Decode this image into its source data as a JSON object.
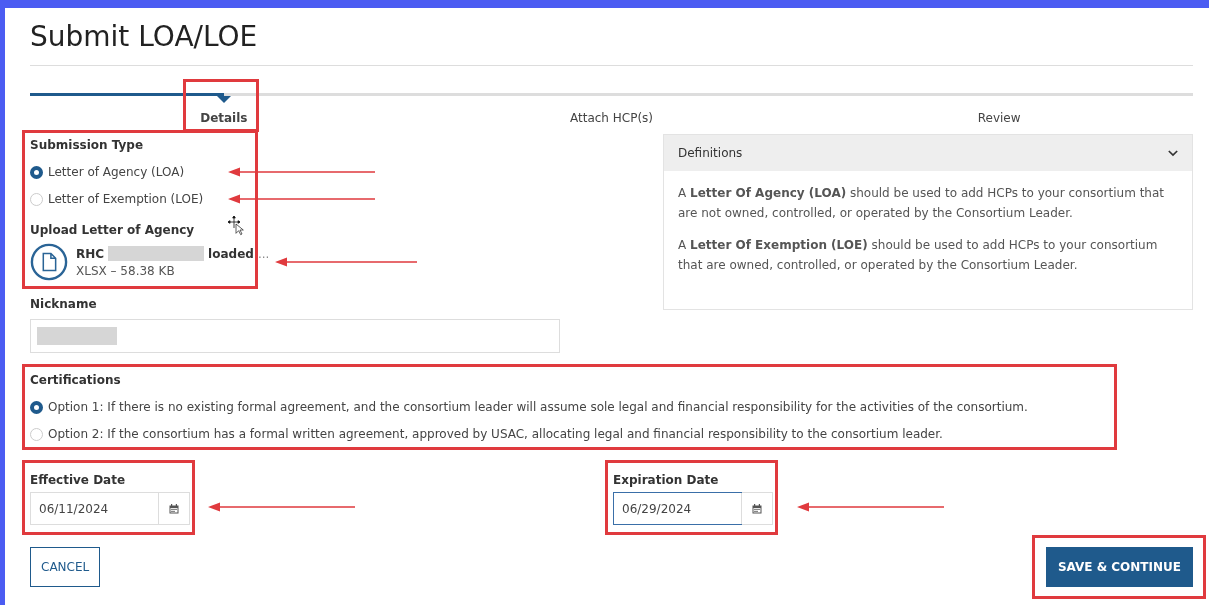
{
  "title": "Submit LOA/LOE",
  "steps": [
    {
      "label": "Details",
      "selected": true
    },
    {
      "label": "Attach HCP(s)",
      "selected": false
    },
    {
      "label": "Review",
      "selected": false
    }
  ],
  "step_progress": {
    "level": 0.167
  },
  "submission_type": {
    "label": "Submission Type",
    "options": [
      {
        "label": "Letter of Agency (LOA)",
        "selected": true
      },
      {
        "label": "Letter of Exemption (LOE)",
        "selected": false
      }
    ]
  },
  "upload": {
    "label": "Upload Letter of Agency",
    "file": {
      "name_start": "RHC",
      "name_end": "loaded",
      "ellipsis": "...",
      "details": "XLSX – 58.38 KB"
    }
  },
  "nickname": {
    "label": "Nickname"
  },
  "definitions": {
    "title": "Definitions",
    "expanded": true,
    "paragraphs": [
      "A **Letter Of Agency (LOA)** should be used to add HCPs to your consortium that are not owned, controlled, or operated by the Consortium Leader.",
      "A **Letter Of Exemption (LOE)** should be used to add HCPs to your consortium that are owned, controlled, or operated by the Consortium Leader."
    ]
  },
  "certifications": {
    "label": "Certifications",
    "options": [
      {
        "label": "Option 1: If there is no existing formal agreement, and the consortium leader will assume sole legal and financial responsibility for the activities of the consortium.",
        "selected": true
      },
      {
        "label": "Option 2: If the consortium has a formal written agreement, approved by USAC, allocating legal and financial responsibility to the consortium leader.",
        "selected": false
      }
    ]
  },
  "effective_date": {
    "label": "Effective Date",
    "value": "06/11/2024",
    "focused": false
  },
  "expiration_date": {
    "label": "Expiration Date",
    "value": "06/29/2024",
    "focused": true
  },
  "buttons": {
    "cancel": "CANCEL",
    "save": "SAVE & CONTINUE"
  }
}
